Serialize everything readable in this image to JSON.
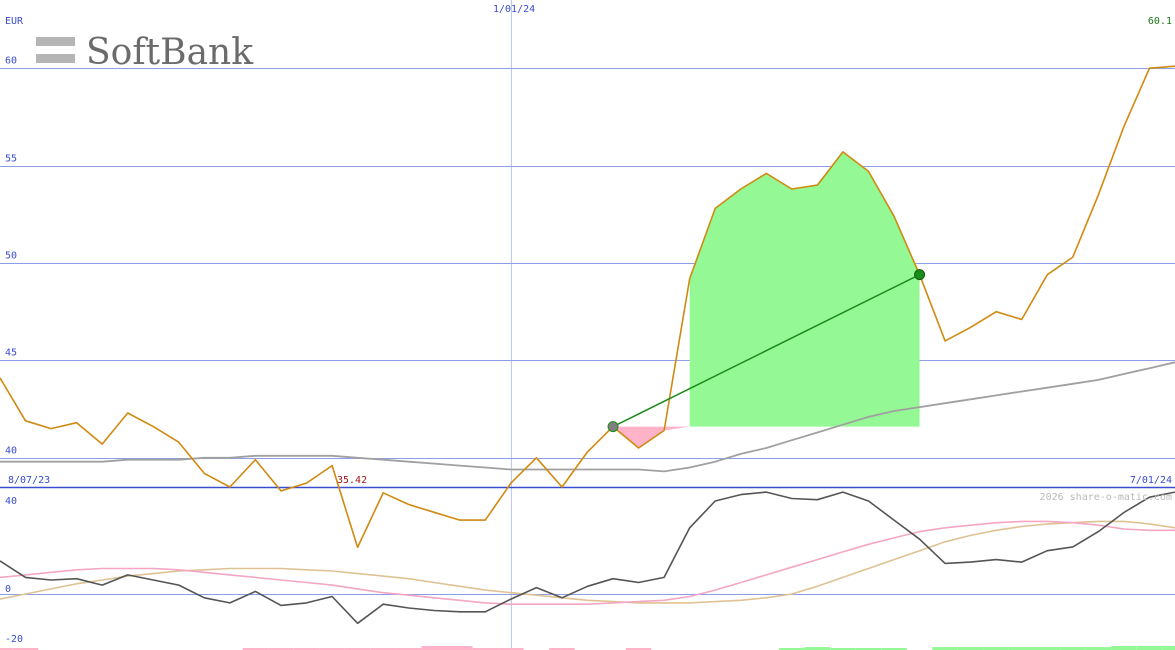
{
  "chart_data": [
    {
      "type": "line",
      "currency": "EUR",
      "logo_text": "SoftBank",
      "ylim": [
        38.5,
        63.5
      ],
      "yticks": [
        40,
        45,
        50,
        55,
        60
      ],
      "x_index_range": [
        0,
        46
      ],
      "date_labels": [
        {
          "text": "8/07/23",
          "index": 0
        },
        {
          "text": "1/01/24",
          "index": 20
        },
        {
          "text": "7/01/24",
          "index": 46
        }
      ],
      "last_value_label": "60.1",
      "min_label": {
        "text": "35.42",
        "index": 14
      },
      "series": [
        {
          "role": "price",
          "color": "#d08a10",
          "values": [
            44.1,
            41.9,
            41.5,
            41.8,
            40.7,
            42.3,
            41.6,
            40.8,
            39.2,
            38.5,
            39.9,
            38.3,
            38.7,
            39.6,
            35.4,
            38.2,
            37.6,
            37.2,
            36.8,
            36.8,
            38.7,
            40.0,
            38.5,
            40.3,
            41.6,
            40.5,
            41.4,
            49.2,
            52.8,
            53.8,
            54.6,
            53.8,
            54.0,
            55.7,
            54.7,
            52.4,
            49.4,
            46.0,
            46.7,
            47.5,
            47.1,
            49.4,
            50.3,
            53.5,
            57.0,
            60.0,
            60.1
          ]
        },
        {
          "role": "moving-average",
          "color": "#a0a0a0",
          "values": [
            39.8,
            39.8,
            39.8,
            39.8,
            39.8,
            39.9,
            39.9,
            39.9,
            40.0,
            40.0,
            40.1,
            40.1,
            40.1,
            40.1,
            40.0,
            39.9,
            39.8,
            39.7,
            39.6,
            39.5,
            39.4,
            39.4,
            39.4,
            39.4,
            39.4,
            39.4,
            39.3,
            39.5,
            39.8,
            40.2,
            40.5,
            40.9,
            41.3,
            41.7,
            42.1,
            42.4,
            42.6,
            42.8,
            43.0,
            43.2,
            43.4,
            43.6,
            43.8,
            44.0,
            44.3,
            44.6,
            44.9
          ]
        }
      ],
      "trade": {
        "entry": {
          "index": 24,
          "value": 41.6
        },
        "exit": {
          "index": 36,
          "value": 49.4
        },
        "gain_color": "#94f994",
        "loss_color": "#ffb3c8",
        "line_color": "#1a8c1a"
      }
    },
    {
      "type": "line",
      "ylim": [
        -22,
        42
      ],
      "yticks": [
        40,
        0,
        -20
      ],
      "watermark": "2026 share-o-matic.com",
      "series": [
        {
          "role": "oscillator",
          "color": "#555555",
          "values": [
            13.0,
            6.5,
            5.5,
            6.0,
            3.5,
            7.5,
            5.5,
            3.5,
            -1.5,
            -3.5,
            1.0,
            -4.5,
            -3.5,
            -1.0,
            -11.5,
            -4.0,
            -5.5,
            -6.5,
            -7.0,
            -7.0,
            -2.0,
            2.5,
            -1.5,
            3.0,
            6.0,
            4.5,
            6.5,
            26.0,
            36.5,
            39.0,
            40.0,
            37.5,
            37.0,
            40.0,
            36.5,
            29.0,
            21.5,
            12.0,
            12.5,
            13.5,
            12.5,
            17.0,
            18.5,
            24.5,
            32.0,
            38.0,
            40.0
          ]
        },
        {
          "role": "signal",
          "color": "#f4a6c4",
          "values": [
            6.5,
            7.5,
            8.5,
            9.5,
            10.0,
            10.0,
            10.0,
            9.5,
            8.5,
            7.5,
            6.5,
            5.5,
            4.5,
            3.5,
            2.0,
            0.5,
            -0.5,
            -1.5,
            -2.5,
            -3.5,
            -4.0,
            -4.0,
            -4.0,
            -4.0,
            -3.5,
            -3.0,
            -2.5,
            -1.0,
            1.5,
            4.5,
            7.5,
            10.5,
            13.5,
            16.5,
            19.5,
            22.0,
            24.5,
            26.0,
            27.0,
            28.0,
            28.5,
            28.5,
            28.0,
            27.0,
            25.5,
            25.0,
            25.0
          ]
        },
        {
          "role": "signal-2",
          "color": "#dfc294",
          "values": [
            -2.0,
            0.0,
            2.0,
            4.0,
            5.5,
            7.0,
            8.0,
            9.0,
            9.5,
            10.0,
            10.0,
            10.0,
            9.5,
            9.0,
            8.0,
            7.0,
            6.0,
            4.5,
            3.0,
            1.5,
            0.5,
            -0.5,
            -1.5,
            -2.5,
            -3.0,
            -3.5,
            -3.5,
            -3.5,
            -3.0,
            -2.5,
            -1.5,
            0.0,
            3.0,
            6.5,
            10.0,
            13.5,
            17.0,
            20.5,
            23.0,
            25.0,
            26.5,
            27.5,
            28.0,
            28.5,
            28.5,
            27.5,
            26.0
          ]
        }
      ],
      "histogram": {
        "negative_color": "#ffb3c8",
        "positive_color": "#94f994",
        "values": [
          -2,
          -2,
          0,
          0,
          0,
          0,
          0,
          0,
          0,
          0,
          -2,
          -2,
          -2,
          -2,
          -2,
          -2,
          -2,
          -4,
          -4,
          -2,
          -2,
          0,
          -2,
          0,
          0,
          -2,
          0,
          0,
          0,
          0,
          0,
          2,
          3,
          2,
          2,
          2,
          0,
          3,
          3,
          3,
          3,
          3,
          3,
          3,
          4,
          4,
          4
        ]
      }
    }
  ]
}
